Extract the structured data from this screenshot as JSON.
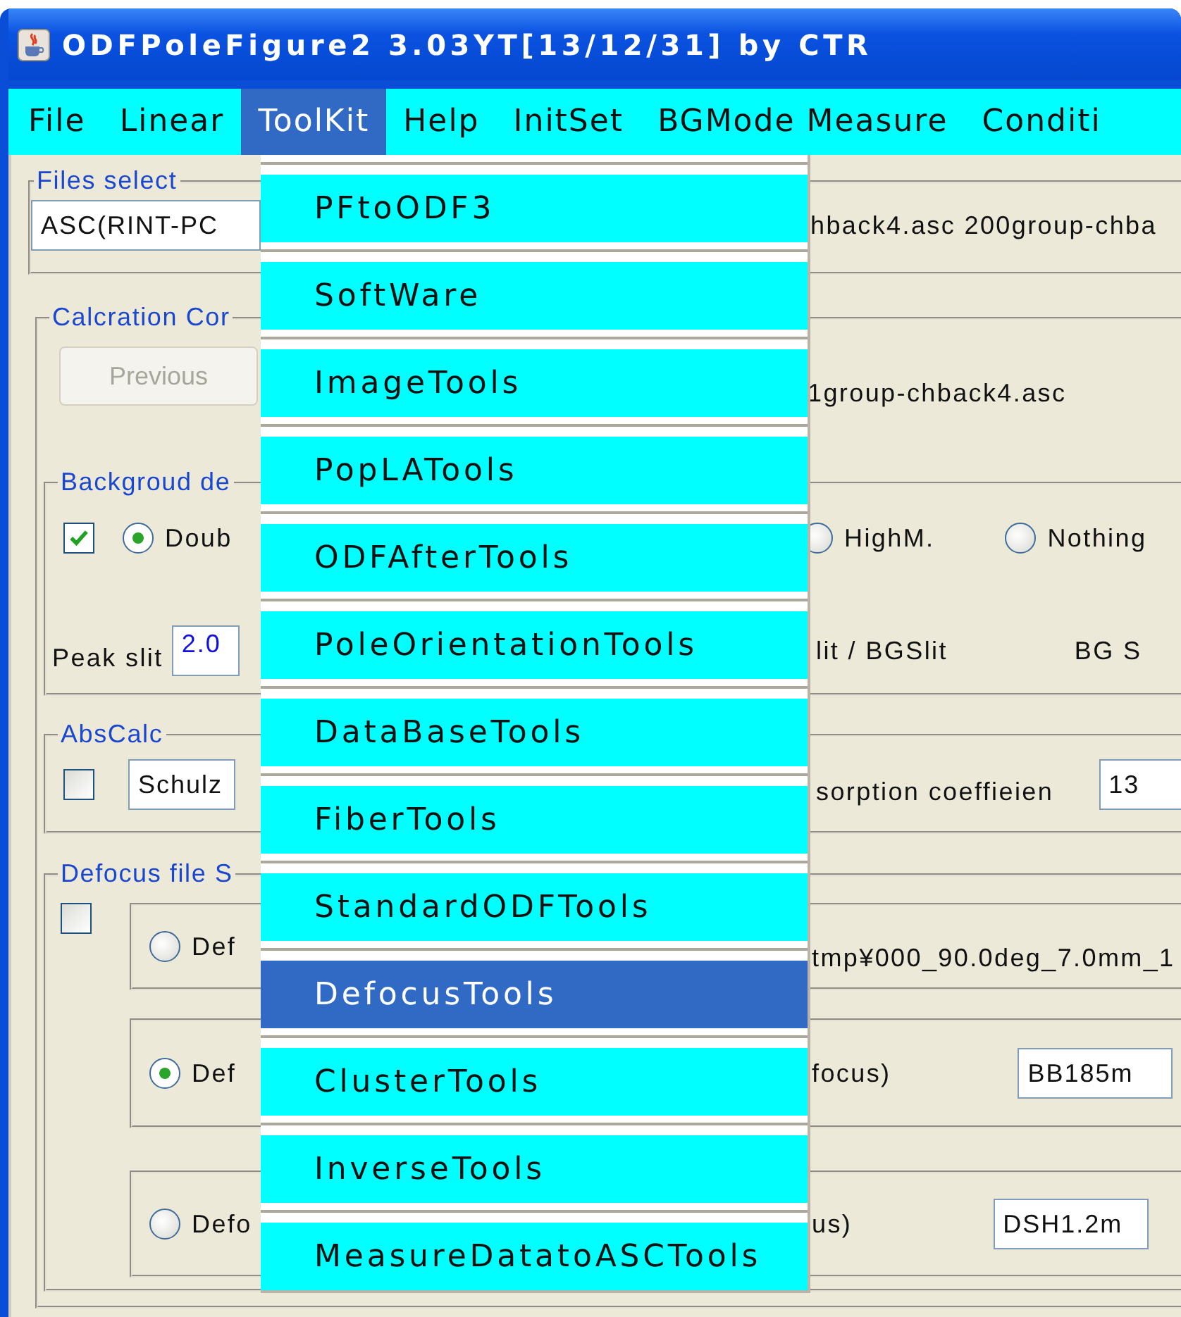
{
  "window": {
    "title": "ODFPoleFigure2 3.03YT[13/12/31] by CTR"
  },
  "menu_bar": [
    {
      "label": "File",
      "selected": false
    },
    {
      "label": "Linear",
      "selected": false
    },
    {
      "label": "ToolKit",
      "selected": true
    },
    {
      "label": "Help",
      "selected": false
    },
    {
      "label": "InitSet",
      "selected": false
    },
    {
      "label": "BGMode Measure",
      "selected": false
    },
    {
      "label": "Conditi",
      "selected": false
    }
  ],
  "toolkit_menu": [
    {
      "label": "PFtoODF3",
      "selected": false
    },
    {
      "label": "SoftWare",
      "selected": false
    },
    {
      "label": "ImageTools",
      "selected": false
    },
    {
      "label": "PopLATools",
      "selected": false
    },
    {
      "label": "ODFAfterTools",
      "selected": false
    },
    {
      "label": "PoleOrientationTools",
      "selected": false
    },
    {
      "label": "DataBaseTools",
      "selected": false
    },
    {
      "label": "FiberTools",
      "selected": false
    },
    {
      "label": "StandardODFTools",
      "selected": false
    },
    {
      "label": "DefocusTools",
      "selected": true
    },
    {
      "label": "ClusterTools",
      "selected": false
    },
    {
      "label": "InverseTools",
      "selected": false
    },
    {
      "label": "MeasureDatatoASCTools",
      "selected": false
    }
  ],
  "files_select": {
    "legend": "Files select",
    "format_field": {
      "value": "ASC(RINT-PC"
    },
    "files_label": "hback4.asc 200group-chba"
  },
  "calculation": {
    "legend": "Calcration Cor",
    "previous_button": {
      "label": "Previous",
      "disabled": true
    },
    "file_label": "1group-chback4.asc",
    "background": {
      "legend": "Backgroud de",
      "checked": true,
      "modes": [
        {
          "label": "Doub",
          "selected": true
        },
        {
          "label": "HighM.",
          "selected": false
        },
        {
          "label": "Nothing",
          "selected": false
        }
      ],
      "peak_slit_label": "Peak slit",
      "peak_slit": {
        "value": "2.0"
      },
      "ratio_label": "lit / BGSlit",
      "bg_label": "BG S"
    },
    "abs_calc": {
      "legend": "AbsCalc",
      "checked": false,
      "method_field": {
        "value": "Schulz"
      },
      "coefficient_label": "sorption coeffieien",
      "coefficient_field": {
        "value": "13"
      }
    },
    "defocus": {
      "legend": "Defocus file S",
      "checked": false,
      "options": [
        {
          "label": "Def",
          "selected": false,
          "caption": "tmp¥000_90.0deg_7.0mm_1"
        },
        {
          "label": "Def",
          "selected": true,
          "caption": "focus)",
          "field": {
            "value": "BB185m"
          }
        },
        {
          "label": "Defo",
          "selected": false,
          "caption": "us)",
          "field": {
            "value": "DSH1.2m"
          }
        }
      ]
    }
  }
}
